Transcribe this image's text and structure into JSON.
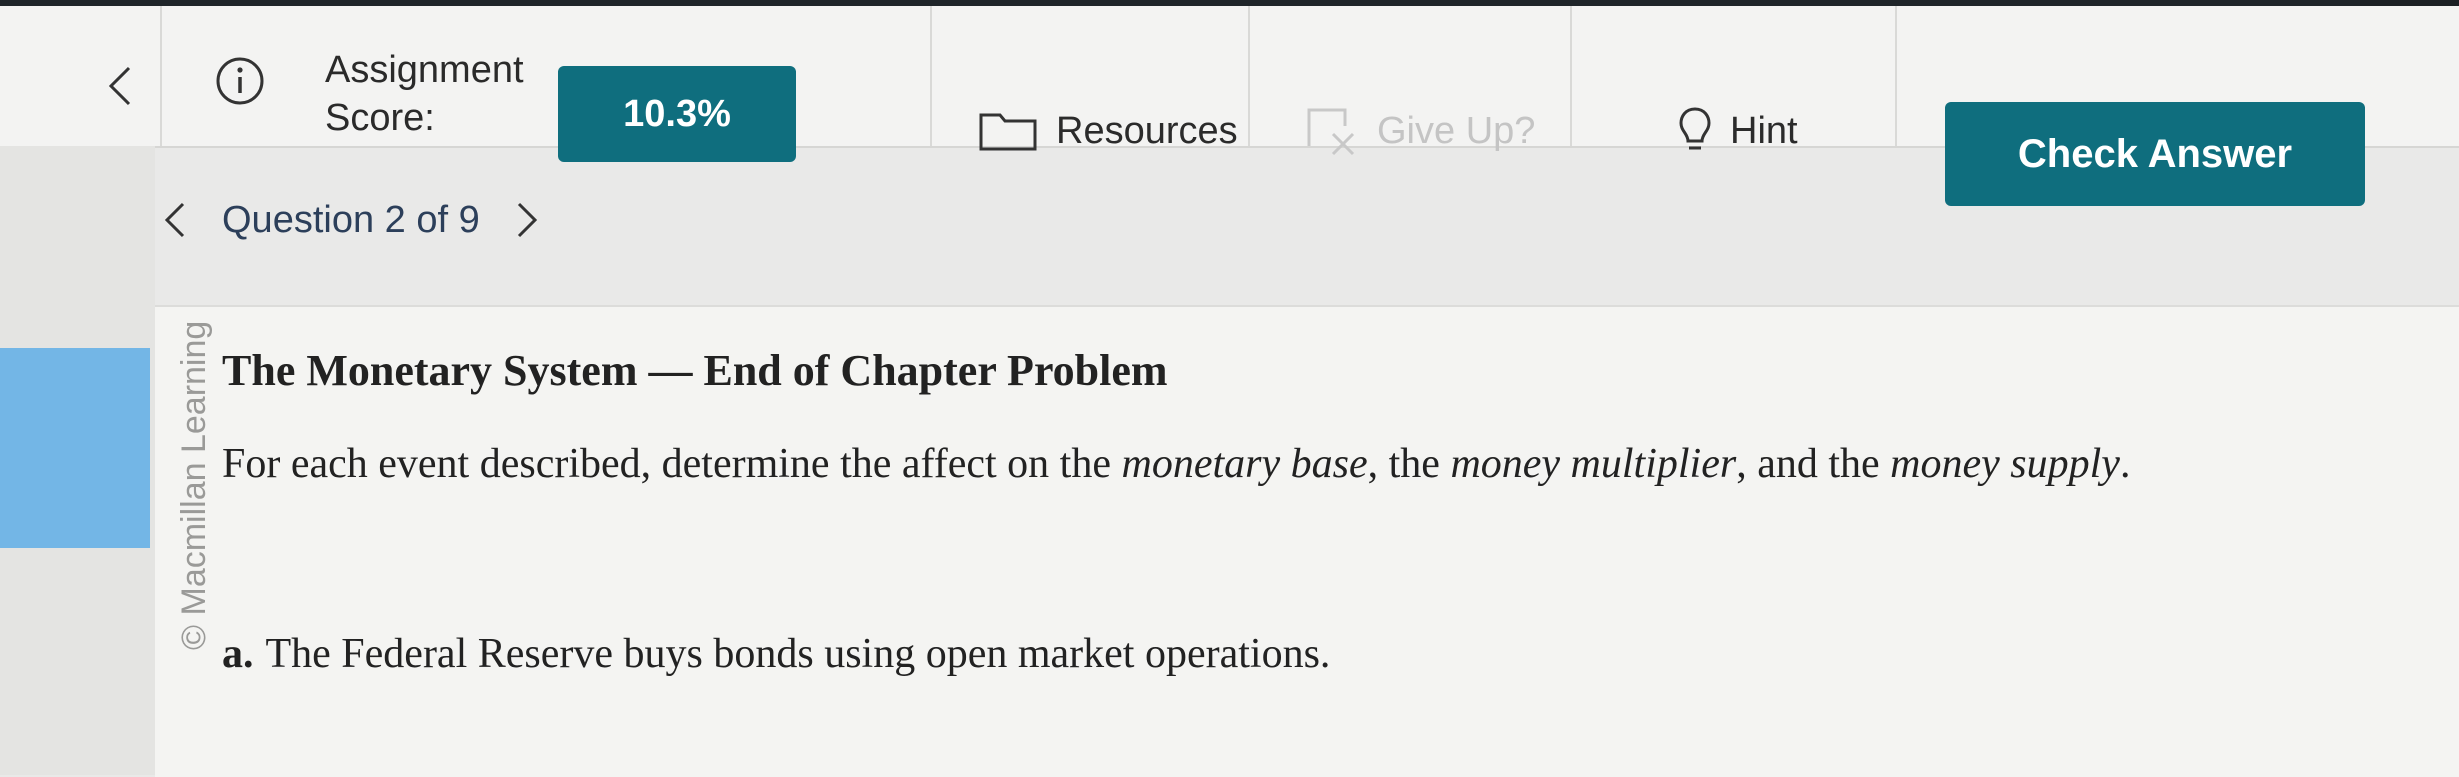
{
  "topbar": {
    "score_label": "Assignment Score:",
    "score_value": "10.3%",
    "resources_label": "Resources",
    "giveup_label": "Give Up?",
    "hint_label": "Hint",
    "check_answer_label": "Check Answer"
  },
  "question_nav": {
    "label": "Question 2 of 9"
  },
  "sidebar": {
    "credit": "© Macmillan Learning"
  },
  "problem": {
    "title": "The Monetary System — End of Chapter Problem",
    "instruction_prefix": "For each event described, determine the affect on the ",
    "term1": "monetary base",
    "sep1": ", the ",
    "term2": "money multiplier",
    "sep2": ", and the ",
    "term3": "money supply",
    "suffix": ".",
    "part_a_marker": "a.",
    "part_a_text": "The Federal Reserve buys bonds using open market operations."
  },
  "colors": {
    "accent": "#0f6e7e",
    "sidebar_highlight": "#73b6e6"
  },
  "icons": [
    "chevron-left-icon",
    "info-icon",
    "folder-icon",
    "give-up-icon",
    "lightbulb-icon",
    "chevron-right-icon"
  ]
}
